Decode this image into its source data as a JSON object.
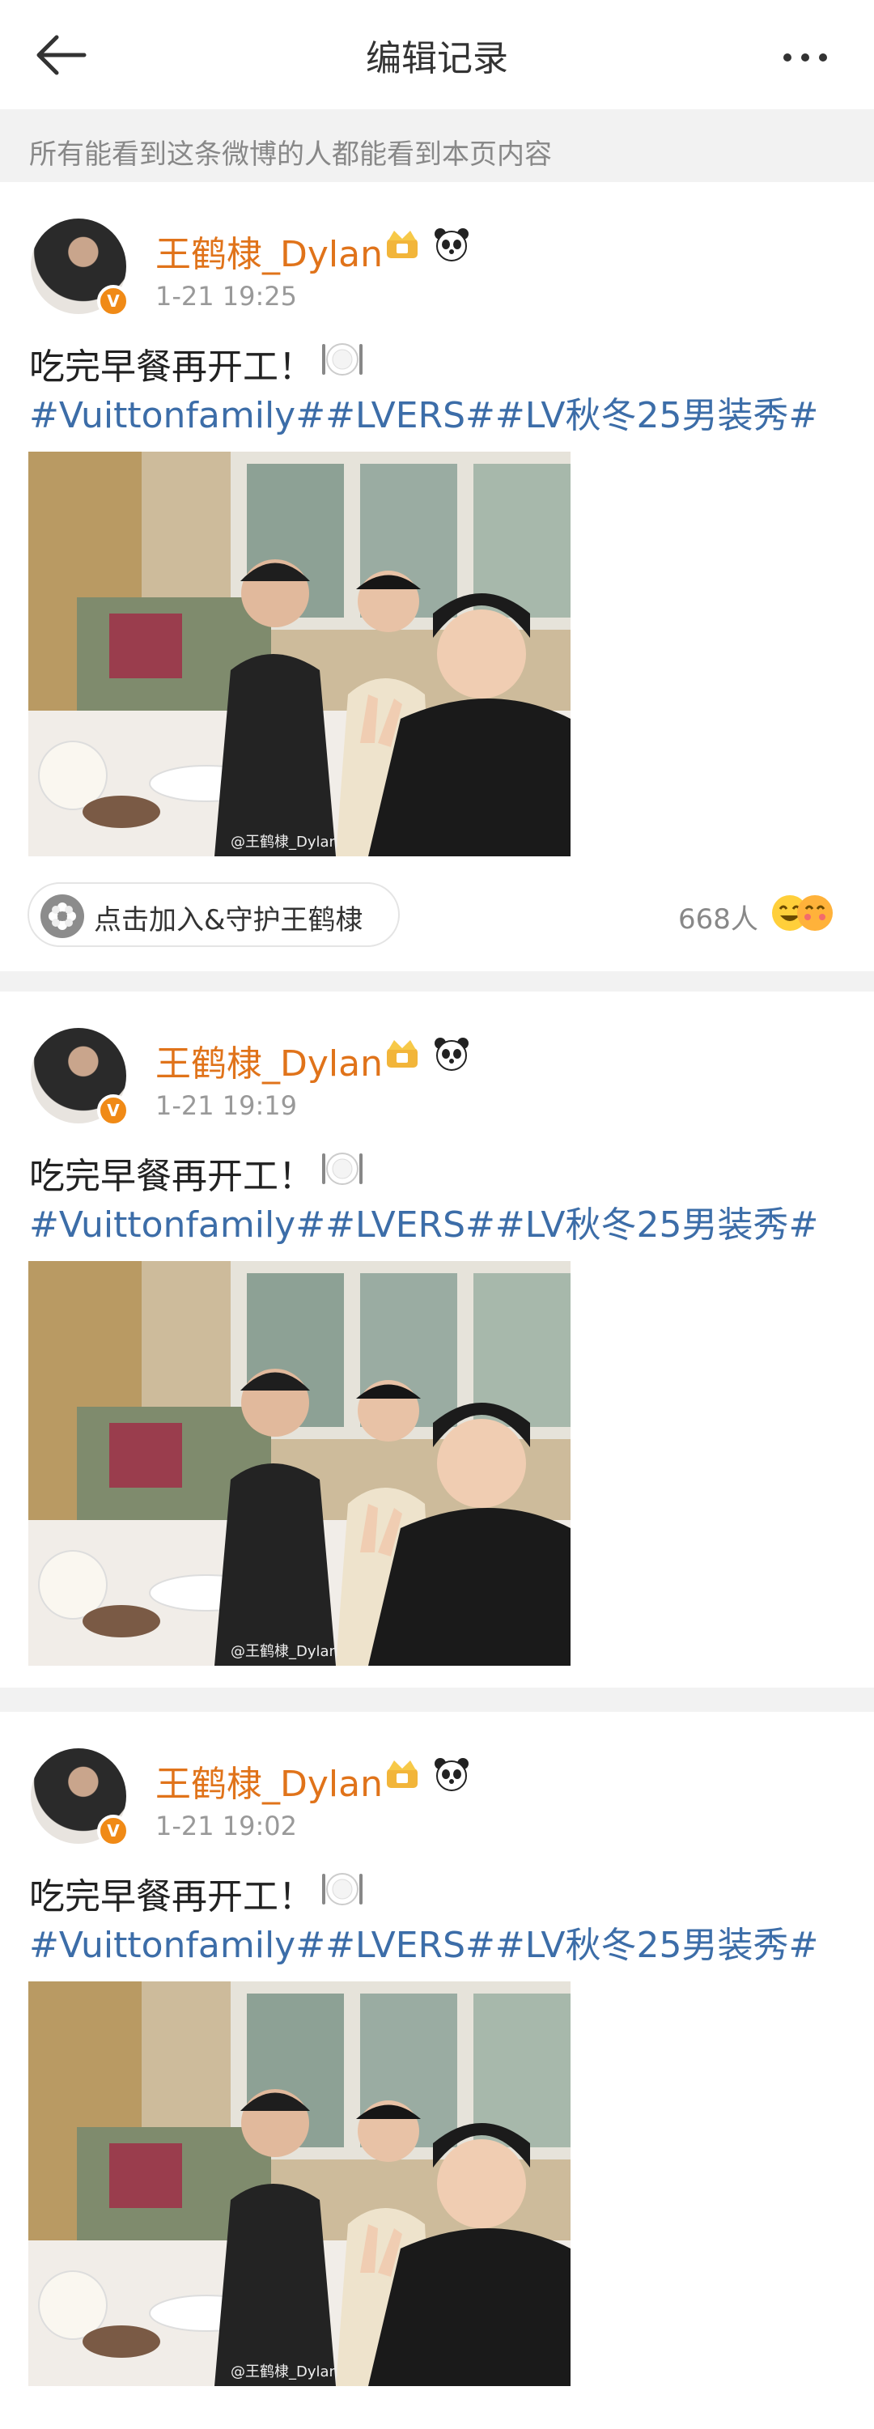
{
  "header": {
    "title": "编辑记录",
    "back_icon": "arrow-left-icon",
    "more_icon": "more-dots-icon"
  },
  "notice": {
    "text": "所有能看到这条微博的人都能看到本页内容"
  },
  "colors": {
    "username": "#e0731a",
    "topic": "#3c6da8",
    "verified": "#f08a16"
  },
  "posts": [
    {
      "username": "王鹤棣_Dylan",
      "time": "1-21 19:25",
      "text": "吃完早餐再开工！",
      "tags": "#Vuittonfamily##LVERS##LV秋冬25男装秀#",
      "watermark": "@王鹤棣_Dylan",
      "fan_button": "点击加入&守护王鹤棣",
      "fan_count": "668人"
    },
    {
      "username": "王鹤棣_Dylan",
      "time": "1-21 19:19",
      "text": "吃完早餐再开工！",
      "tags": "#Vuittonfamily##LVERS##LV秋冬25男装秀#",
      "watermark": "@王鹤棣_Dylan"
    },
    {
      "username": "王鹤棣_Dylan",
      "time": "1-21 19:02",
      "text": "吃完早餐再开工！",
      "tags": "#Vuittonfamily##LVERS##LV秋冬25男装秀#",
      "watermark": "@王鹤棣_Dylan"
    }
  ]
}
